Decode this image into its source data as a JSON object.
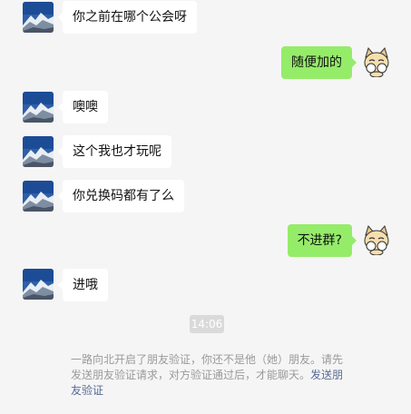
{
  "colors": {
    "background": "#f5f5f5",
    "incoming_bubble": "#ffffff",
    "outgoing_bubble": "#95ec69",
    "link": "#576b95",
    "notice_text": "#9a9a9a"
  },
  "messages": [
    {
      "side": "left",
      "text": "你之前在哪个公会呀",
      "avatar": "mountain-avatar"
    },
    {
      "side": "right",
      "text": "随便加的",
      "avatar": "cat-avatar"
    },
    {
      "side": "left",
      "text": "噢噢",
      "avatar": "mountain-avatar"
    },
    {
      "side": "left",
      "text": "这个我也才玩呢",
      "avatar": "mountain-avatar"
    },
    {
      "side": "left",
      "text": "你兑换码都有了么",
      "avatar": "mountain-avatar"
    },
    {
      "side": "right",
      "text": "不进群?",
      "avatar": "cat-avatar"
    },
    {
      "side": "left",
      "text": "进哦",
      "avatar": "mountain-avatar"
    }
  ],
  "timestamp": "14:06",
  "system_notice": {
    "text": "一路向北开启了朋友验证，你还不是他（她）朋友。请先发送朋友验证请求，对方验证通过后，才能聊天。",
    "link": "发送朋友验证"
  }
}
